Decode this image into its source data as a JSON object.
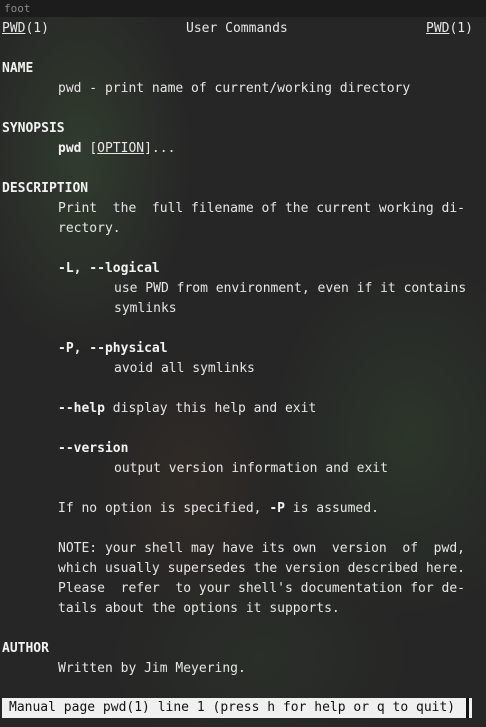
{
  "window": {
    "title": "foot"
  },
  "header": {
    "left_name": "PWD",
    "left_sec": "(1)",
    "center": "User Commands",
    "right_name": "PWD",
    "right_sec": "(1)"
  },
  "name_section": {
    "heading": "NAME",
    "text": "pwd - print name of current/working directory"
  },
  "synopsis": {
    "heading": "SYNOPSIS",
    "cmd": "pwd",
    "open": "[",
    "option": "OPTION",
    "close": "]..."
  },
  "description": {
    "heading": "DESCRIPTION",
    "line1": "Print  the  full filename of the current working di-",
    "line2": "rectory.",
    "logical_flag": "-L, --logical",
    "logical_line1": "use PWD from environment, even if it contains",
    "logical_line2": "symlinks",
    "physical_flag": "-P, --physical",
    "physical_text": "avoid all symlinks",
    "help_flag": "--help",
    "help_text": " display this help and exit",
    "version_flag": "--version",
    "version_text": "output version information and exit",
    "noopt_pre": "If no option is specified, ",
    "noopt_flag": "-P",
    "noopt_post": " is assumed.",
    "note_line1": "NOTE: your shell may have its own  version  of  pwd,",
    "note_line2": "which usually supersedes the version described here.",
    "note_line3": "Please  refer  to your shell's documentation for de-",
    "note_line4": "tails about the options it supports."
  },
  "author": {
    "heading": "AUTHOR",
    "text": "Written by Jim Meyering."
  },
  "status_bar": {
    "text": "Manual page pwd(1) line 1 (press h for help or q to quit)"
  }
}
